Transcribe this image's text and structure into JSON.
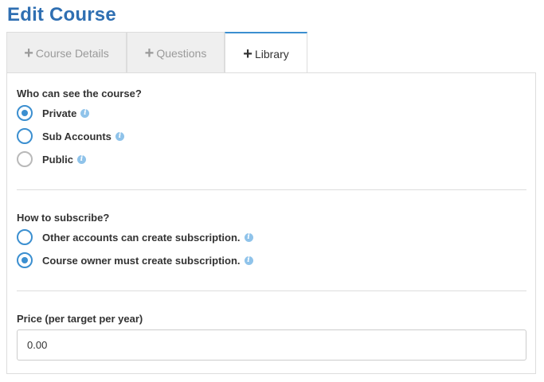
{
  "page": {
    "title": "Edit Course"
  },
  "tabs": [
    {
      "label": "Course Details",
      "active": false
    },
    {
      "label": "Questions",
      "active": false
    },
    {
      "label": "Library",
      "active": true
    }
  ],
  "visibility": {
    "label": "Who can see the course?",
    "options": [
      {
        "label": "Private",
        "selected": true
      },
      {
        "label": "Sub Accounts",
        "selected": false
      },
      {
        "label": "Public",
        "selected": false
      }
    ]
  },
  "subscription": {
    "label": "How to subscribe?",
    "options": [
      {
        "label": "Other accounts can create subscription.",
        "selected": false
      },
      {
        "label": "Course owner must create subscription.",
        "selected": true
      }
    ]
  },
  "price": {
    "label": "Price (per target per year)",
    "value": "0.00"
  },
  "colors": {
    "title": "#2f6fb2",
    "accent": "#3b8fd0",
    "info_icon": "#8fc3ea"
  },
  "icons": {
    "tab_icon": "plus-icon",
    "help_icon": "info-icon"
  }
}
